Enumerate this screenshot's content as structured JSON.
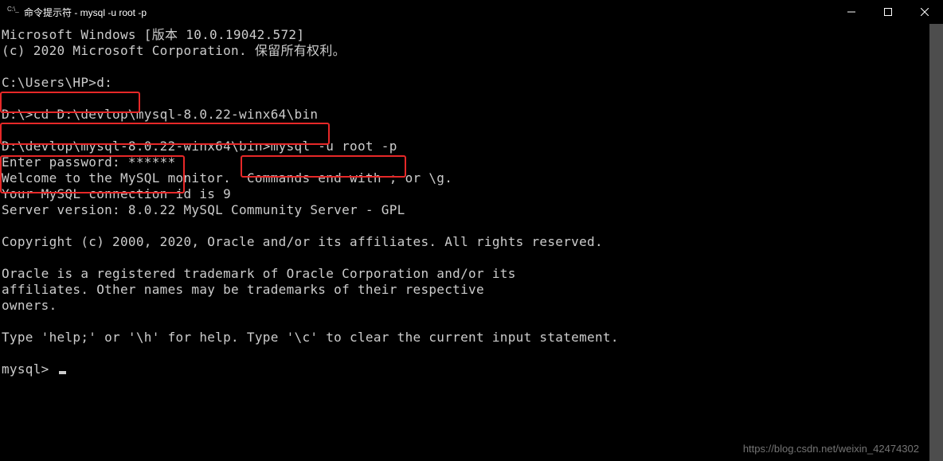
{
  "titlebar": {
    "title": "命令提示符 - mysql  -u root -p"
  },
  "lines": {
    "l0": "Microsoft Windows [版本 10.0.19042.572]",
    "l1": "(c) 2020 Microsoft Corporation. 保留所有权利。",
    "l2": "",
    "l3": "C:\\Users\\HP>d:",
    "l4": "",
    "l5": "D:\\>cd D:\\devlop\\mysql-8.0.22-winx64\\bin",
    "l6": "",
    "l7": "D:\\devlop\\mysql-8.0.22-winx64\\bin>mysql -u root -p",
    "l8": "Enter password: ******",
    "l9": "Welcome to the MySQL monitor.  Commands end with ; or \\g.",
    "l10": "Your MySQL connection id is 9",
    "l11": "Server version: 8.0.22 MySQL Community Server - GPL",
    "l12": "",
    "l13": "Copyright (c) 2000, 2020, Oracle and/or its affiliates. All rights reserved.",
    "l14": "",
    "l15": "Oracle is a registered trademark of Oracle Corporation and/or its",
    "l16": "affiliates. Other names may be trademarks of their respective",
    "l17": "owners.",
    "l18": "",
    "l19": "Type 'help;' or '\\h' for help. Type '\\c' to clear the current input statement.",
    "l20": "",
    "l21": "mysql> "
  },
  "watermark": "https://blog.csdn.net/weixin_42474302"
}
